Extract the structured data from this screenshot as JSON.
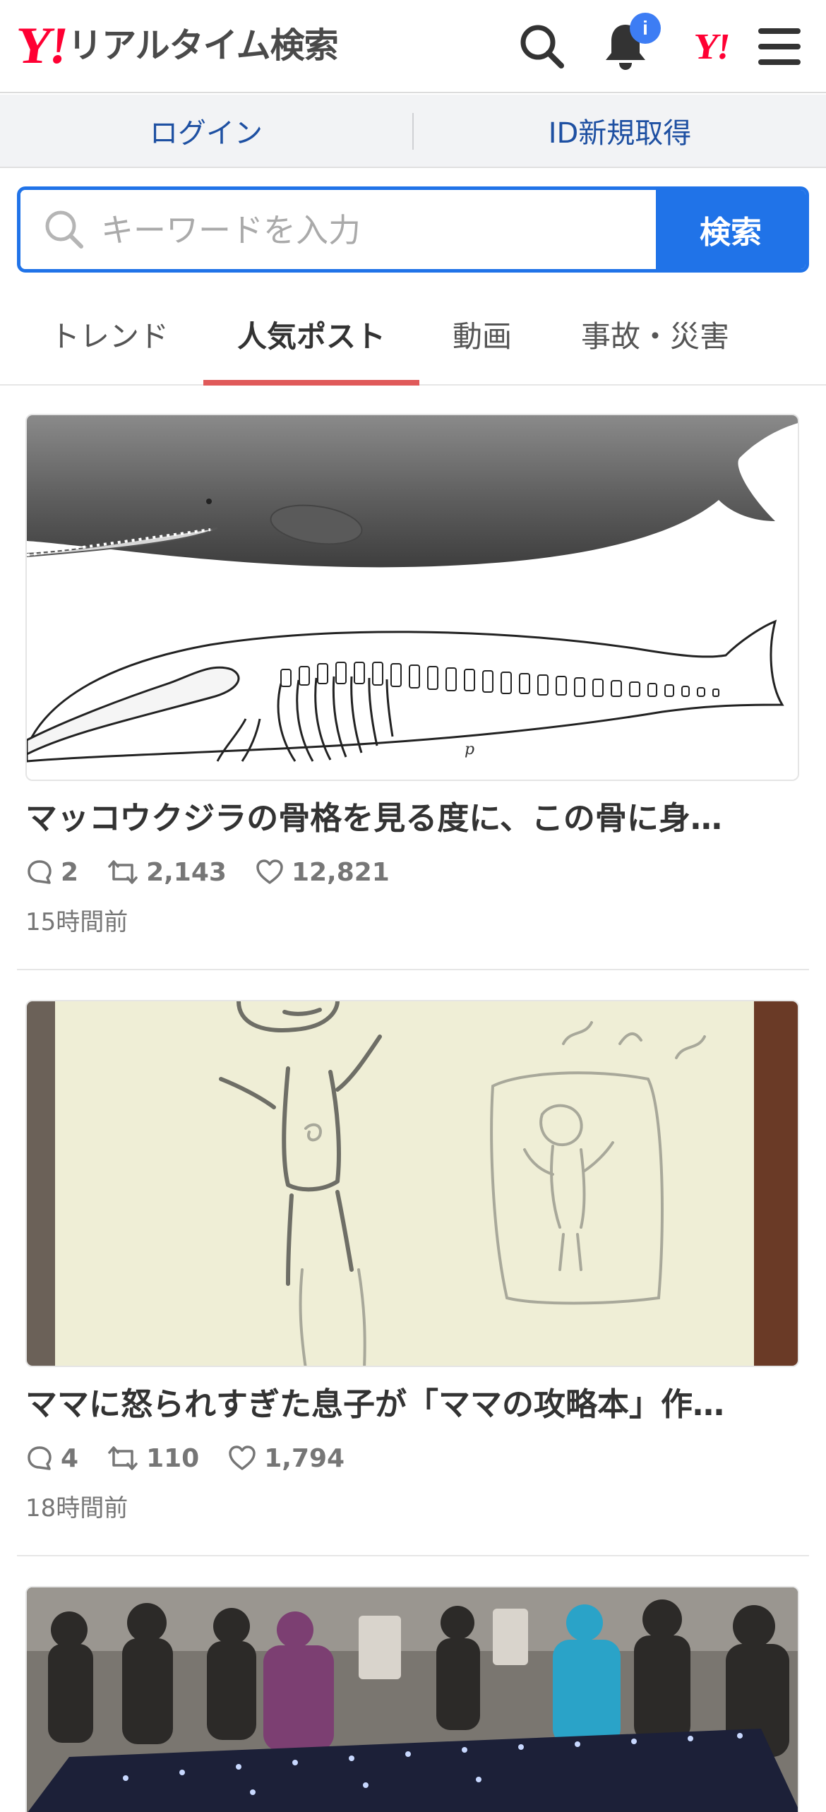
{
  "header": {
    "logo_mark": "Y!",
    "logo_text": "リアルタイム検索",
    "notification_badge": "i",
    "yahoo_mini": "Y!"
  },
  "auth": {
    "login": "ログイン",
    "signup": "ID新規取得"
  },
  "search": {
    "placeholder": "キーワードを入力",
    "button": "検索"
  },
  "tabs": [
    {
      "label": "トレンド",
      "active": false
    },
    {
      "label": "人気ポスト",
      "active": true
    },
    {
      "label": "動画",
      "active": false
    },
    {
      "label": "事故・災害",
      "active": false
    }
  ],
  "posts": [
    {
      "title": "マッコウクジラの骨格を見る度に、この骨に身…",
      "replies": "2",
      "reposts": "2,143",
      "likes": "12,821",
      "time": "15時間前"
    },
    {
      "title": "ママに怒られすぎた息子が「ママの攻略本」作…",
      "replies": "4",
      "reposts": "110",
      "likes": "1,794",
      "time": "18時間前"
    },
    {
      "title": "",
      "replies": "",
      "reposts": "",
      "likes": "",
      "time": ""
    }
  ],
  "colors": {
    "brand_red": "#ff0033",
    "search_blue": "#2073e8",
    "link_blue": "#1e50a2",
    "tab_underline": "#e05a5a",
    "badge_blue": "#3d7df4"
  }
}
